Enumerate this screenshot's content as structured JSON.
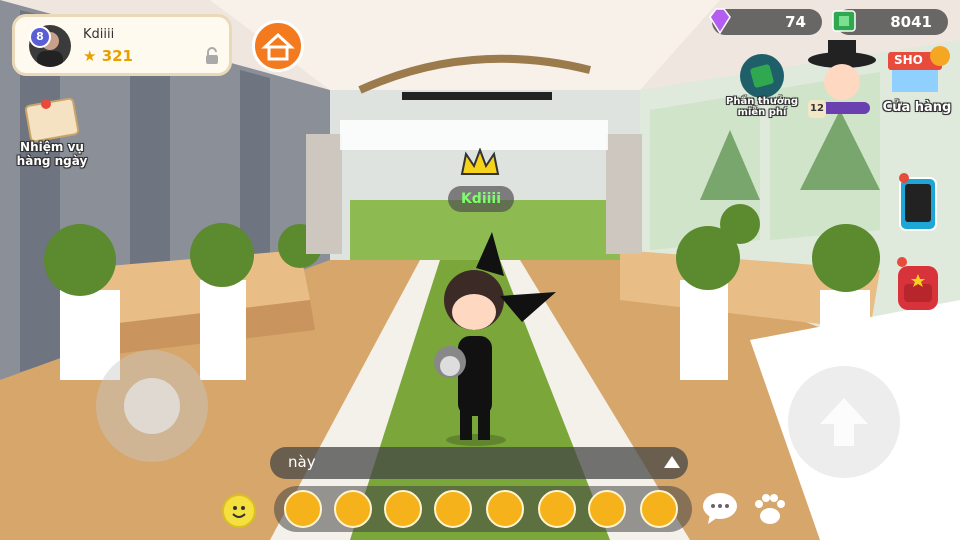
{
  "profile": {
    "username": "Kdiiii",
    "level": "8",
    "stars": "321"
  },
  "currency": {
    "gems": "74",
    "cash": "8041"
  },
  "buttons": {
    "free_reward": "Phần thưởng miễn phí",
    "shop": "Cửa hàng",
    "shop_sign": "SHO",
    "profile_level": "12",
    "daily_quest": "Nhiệm vụ hàng ngày"
  },
  "player": {
    "nametag": "Kdiiii"
  },
  "chat": {
    "text": "này"
  },
  "colors": {
    "accent": "#f47a1f",
    "grass": "#7aa63a",
    "wood": "#d7a66b",
    "wall": "#8a8f98",
    "nametag": "#7dff6a"
  },
  "icons": [
    "lock-icon",
    "home-icon",
    "gem-icon",
    "cash-icon",
    "smile-icon",
    "speech-bubble-icon",
    "paw-icon",
    "phone-icon",
    "backpack-icon",
    "arrow-up-icon",
    "crown-icon",
    "map-pin-icon"
  ]
}
